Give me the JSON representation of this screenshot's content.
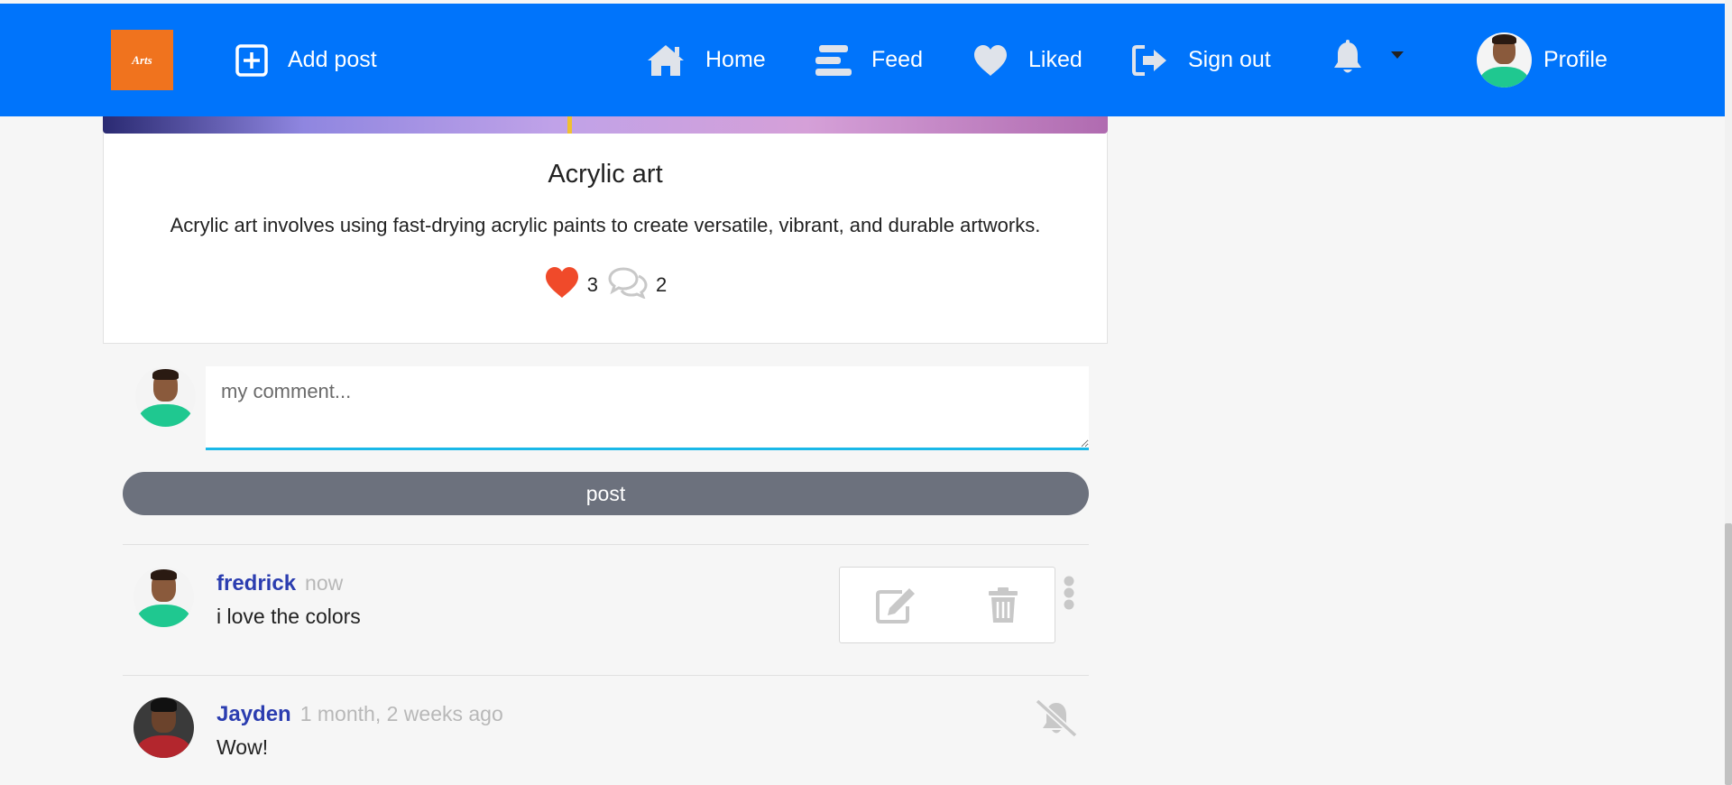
{
  "navbar": {
    "logo_text": "Arts",
    "add_post": "Add post",
    "home": "Home",
    "feed": "Feed",
    "liked": "Liked",
    "sign_out": "Sign out",
    "profile": "Profile"
  },
  "post": {
    "title": "Acrylic art",
    "description": "Acrylic art involves using fast-drying acrylic paints to create versatile, vibrant, and durable artworks.",
    "likes": "3",
    "comments": "2"
  },
  "composer": {
    "placeholder": "my comment...",
    "post_label": "post"
  },
  "comments": [
    {
      "author": "fredrick",
      "time": "now",
      "text": "i love the colors"
    },
    {
      "author": "Jayden",
      "time": "1 month, 2 weeks ago",
      "text": "Wow!"
    }
  ],
  "colors": {
    "navbar": "#0074fb",
    "logo": "#f0731e",
    "like": "#f04a2a",
    "author": "#2b3db0",
    "post_button": "#6c717d",
    "input_focus": "#1ab8e8"
  }
}
